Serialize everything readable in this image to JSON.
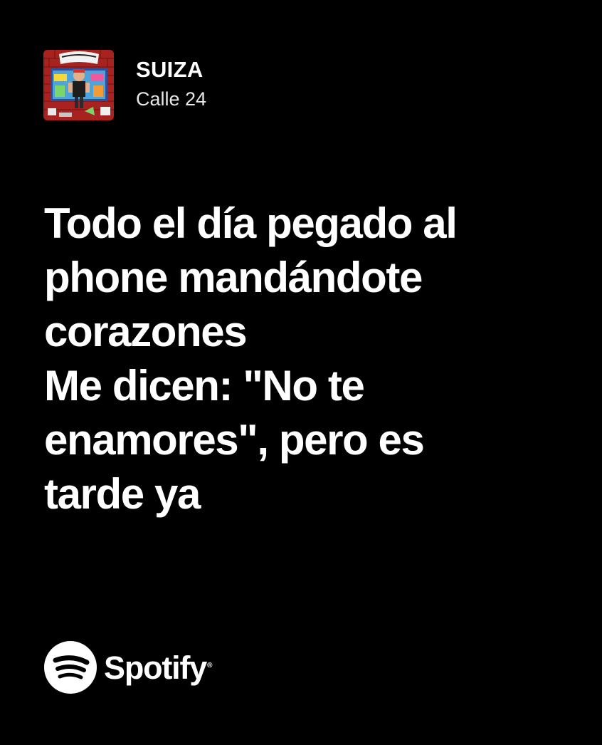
{
  "header": {
    "song_title": "SUIZA",
    "artist": "Calle 24",
    "cover_icon": "album-cover"
  },
  "lyrics": [
    "Todo el día pegado al",
    "phone mandándote",
    "corazones",
    "Me dicen: \"No te",
    "enamores\", pero es",
    "tarde ya"
  ],
  "brand": {
    "name": "Spotify",
    "trademark": "®",
    "icon": "spotify-logo-icon"
  },
  "colors": {
    "background": "#000000",
    "text": "#ffffff",
    "logo_circle": "#ffffff"
  }
}
